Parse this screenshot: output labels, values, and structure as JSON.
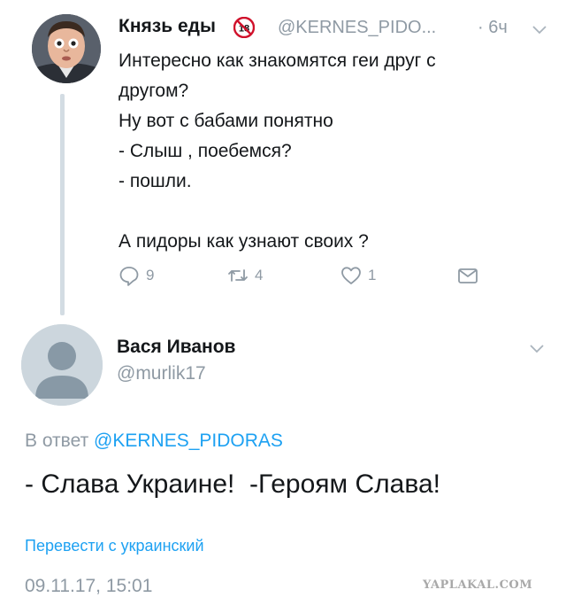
{
  "tweet": {
    "author_name": "Князь еды",
    "author_handle": "@KERNES_PIDO...",
    "time": "· 6ч",
    "text": "Интересно как знакомятся геи друг с\nдругом?\nНу вот с бабами понятно\n- Слыш , поебемся?\n- пошли.\n\nА пидоры как узнают своих ?",
    "reply_count": "9",
    "retweet_count": "4",
    "like_count": "1",
    "icons": [
      "reply-icon",
      "retweet-icon",
      "like-icon",
      "message-icon",
      "chevron-down-icon",
      "age-18-icon"
    ]
  },
  "reply": {
    "author_name": "Вася Иванов",
    "author_handle": "@murlik17",
    "reply_prefix": "В ответ",
    "reply_to": "@KERNES_PIDORAS",
    "text": "- Слава Украине!  -Героям Слава!",
    "translate_label": "Перевести с украинский",
    "timestamp": "09.11.17, 15:01"
  },
  "watermark": "YAPLAKAL.COM",
  "colors": {
    "link": "#1da1f2",
    "muted": "#8f9aa4",
    "text": "#14171a",
    "thread_line": "#d3dce3"
  }
}
